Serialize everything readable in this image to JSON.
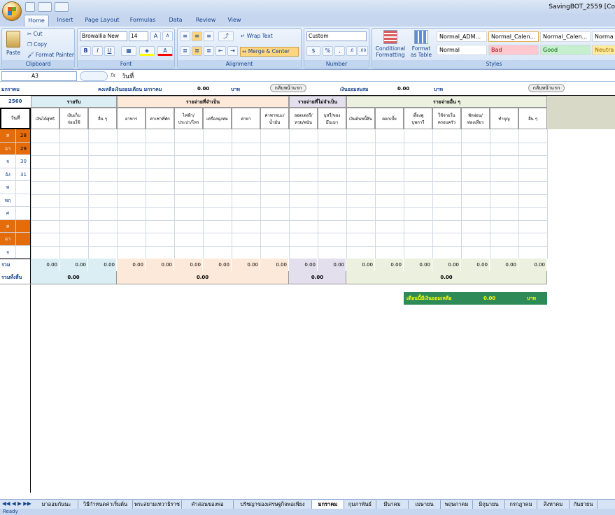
{
  "window": {
    "title": "SavingBOT_2559  [Co"
  },
  "tabs": [
    "Home",
    "Insert",
    "Page Layout",
    "Formulas",
    "Data",
    "Review",
    "View"
  ],
  "ribbon": {
    "clipboard": {
      "paste": "Paste",
      "cut": "Cut",
      "copy": "Copy",
      "format_painter": "Format Painter",
      "label": "Clipboard"
    },
    "font": {
      "name": "Browallia New",
      "size": "14",
      "label": "Font"
    },
    "alignment": {
      "wrap": "Wrap Text",
      "merge": "Merge & Center",
      "label": "Alignment"
    },
    "number": {
      "format": "Custom",
      "label": "Number"
    },
    "styles": {
      "conditional": "Conditional",
      "conditional2": "Formatting",
      "format_table": "Format",
      "format_table2": "as Table",
      "label": "Styles",
      "items": [
        {
          "name": "Normal_ADM...",
          "bg": "#ffffff",
          "fg": "#000000"
        },
        {
          "name": "Normal_Calen...",
          "bg": "#ffffff",
          "fg": "#000000"
        },
        {
          "name": "Normal_Calen...",
          "bg": "#ffffff",
          "fg": "#000000"
        },
        {
          "name": "Norma",
          "bg": "#ffffff",
          "fg": "#000000"
        },
        {
          "name": "Normal",
          "bg": "#ffffff",
          "fg": "#000000"
        },
        {
          "name": "Bad",
          "bg": "#ffc7ce",
          "fg": "#9c0006"
        },
        {
          "name": "Good",
          "bg": "#c6efce",
          "fg": "#006100"
        },
        {
          "name": "Neutra",
          "bg": "#ffeb9c",
          "fg": "#9c6500"
        }
      ]
    }
  },
  "formula": {
    "namebox": "A3",
    "fx": "fx",
    "value": "วันที่"
  },
  "sheet": {
    "month": "มกราคม",
    "year": "2560",
    "balance_label": "คงเหลือเงินออมเดือน มกราคม",
    "balance_value": "0.00",
    "baht": "บาท",
    "back_btn": "กลับหน้าแรก",
    "savings_label": "เงินออมสะสม",
    "savings_value": "0.00",
    "sections": {
      "income": "รายรับ",
      "necessary": "รายจ่ายที่จำเป็น",
      "unnecessary": "รายจ่ายที่ไม่จำเป็น",
      "other": "รายจ่ายอื่น ๆ"
    },
    "day_header": "วันที่",
    "headers": [
      "เงินได้สุทธิ",
      "เงินเก็บ|ก่อนใช้",
      "อื่น ๆ",
      "อาหาร",
      "ค่าเช่าที่พัก",
      "ไฟฟ้า/|ประปา/โทร",
      "เครื่องนุ่งห่ม",
      "ค่ายา",
      "ค่าพาหนะ/|น้ำมัน",
      "ลอตเตอรี่/|หวย/พนัน",
      "บุหรี่/ของ|มึนเมา",
      "เงินต้นหนี้สิน",
      "ดอกเบี้ย",
      "เลี้ยงดู|บุพการี",
      "ใช้จ่ายใน|ครอบครัว",
      "พักผ่อน/|ท่องเที่ยว",
      "ทำบุญ",
      "อื่น ๆ"
    ],
    "rows": [
      {
        "dow": "ส",
        "date": "28",
        "weekend": true
      },
      {
        "dow": "อา",
        "date": "29",
        "weekend": true
      },
      {
        "dow": "จ",
        "date": "30",
        "weekend": false
      },
      {
        "dow": "อัง",
        "date": "31",
        "weekend": false
      },
      {
        "dow": "พ",
        "date": "",
        "weekend": false
      },
      {
        "dow": "พฤ",
        "date": "",
        "weekend": false
      },
      {
        "dow": "ศ",
        "date": "",
        "weekend": false
      },
      {
        "dow": "ส",
        "date": "",
        "weekend": true
      },
      {
        "dow": "อา",
        "date": "",
        "weekend": true
      },
      {
        "dow": "จ",
        "date": "",
        "weekend": false
      }
    ],
    "sum_label": "รวม",
    "sum_value": "0.00",
    "total_label": "รวมทั้งสิ้น",
    "remaining_label": "เดือนนี้มีเงินออมเหลือ",
    "remaining_value": "0.00"
  },
  "sheet_tabs": [
    "มาออมกันนะ",
    "วิธีกำหนดค่าเริ่มต้น",
    "พระสยามเทวาธิราช",
    "คำสอนของพ่อ",
    "ปรัชญาของเศรษฐกิจพอเพียง",
    "มกราคม",
    "กุมภาพันธ์",
    "มีนาคม",
    "เมษายน",
    "พฤษภาคม",
    "มิถุนายน",
    "กรกฎาคม",
    "สิงหาคม",
    "กันยายน"
  ],
  "status": "Ready",
  "colors": {
    "income": "#daeef3",
    "necessary": "#fde9d9",
    "unnecessary": "#e4dfec",
    "other": "#ebf1de",
    "weekend": "#e46c0a",
    "green": "#2e8b57"
  }
}
